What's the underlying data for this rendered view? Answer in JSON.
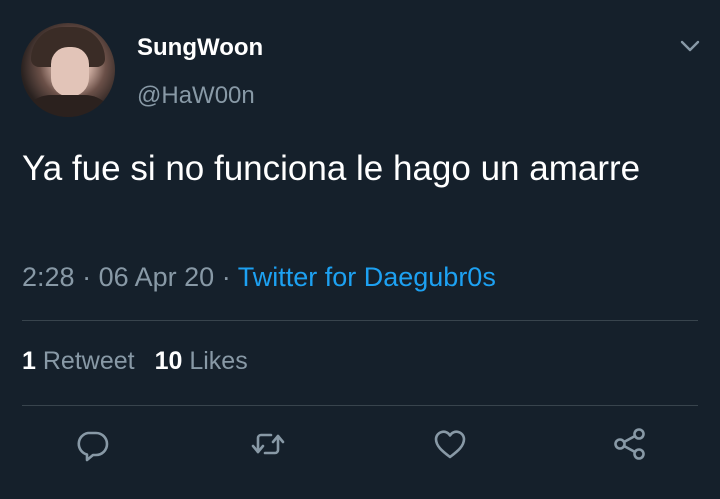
{
  "user": {
    "name": "SungWoon",
    "handle": "@HaW00n"
  },
  "tweet": {
    "text": "Ya fue si no funciona le hago un amarre",
    "time": "2:28",
    "date": "06 Apr 20",
    "separator": "·",
    "source": "Twitter for Daegubr0s"
  },
  "stats": {
    "retweets_count": "1",
    "retweets_label": "Retweet",
    "likes_count": "10",
    "likes_label": "Likes"
  },
  "actions": [
    "reply-icon",
    "retweet-icon",
    "like-icon",
    "share-icon"
  ],
  "colors": {
    "background": "#15202b",
    "text": "#ffffff",
    "secondary": "#8899a6",
    "link": "#1da1f2",
    "divider": "#38444d"
  }
}
